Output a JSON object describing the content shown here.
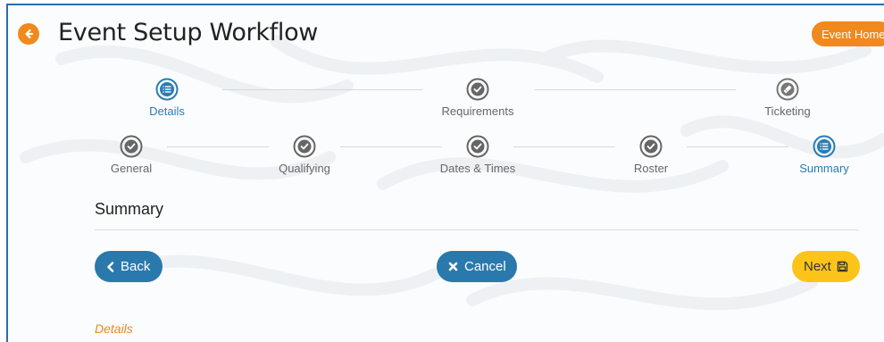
{
  "header": {
    "title": "Event Setup Workflow",
    "home_button": "Event Home"
  },
  "workflow": {
    "main_steps": [
      {
        "label": "Details",
        "icon": "list-icon",
        "state": "active"
      },
      {
        "label": "Requirements",
        "icon": "check-circle-icon",
        "state": "complete"
      },
      {
        "label": "Ticketing",
        "icon": "ticket-icon",
        "state": "pending"
      }
    ],
    "sub_steps": [
      {
        "label": "General",
        "icon": "check-circle-icon",
        "state": "complete"
      },
      {
        "label": "Qualifying",
        "icon": "check-circle-icon",
        "state": "complete"
      },
      {
        "label": "Dates & Times",
        "icon": "check-circle-icon",
        "state": "complete"
      },
      {
        "label": "Roster",
        "icon": "check-circle-icon",
        "state": "complete"
      },
      {
        "label": "Summary",
        "icon": "list-icon",
        "state": "active"
      }
    ]
  },
  "section": {
    "title": "Summary",
    "details_link": "Details"
  },
  "actions": {
    "back_label": "Back",
    "cancel_label": "Cancel",
    "next_label": "Next"
  },
  "colors": {
    "accent_orange": "#f0891e",
    "primary_blue": "#2a79ad",
    "next_yellow": "#fcc419",
    "frame_border": "#2a6faa"
  }
}
